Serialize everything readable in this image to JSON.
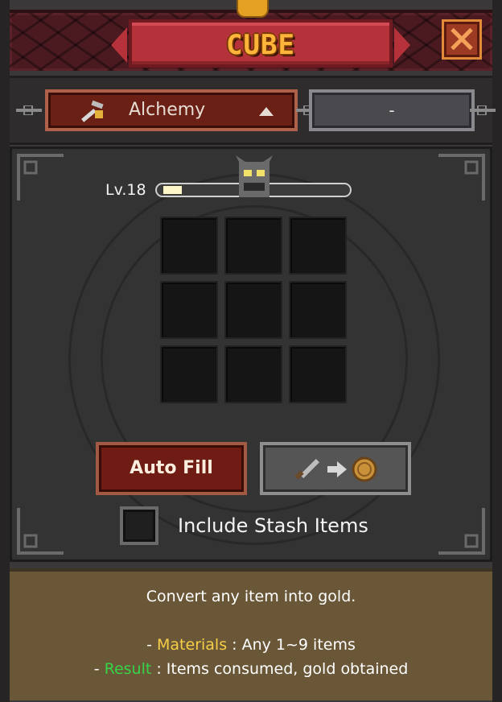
{
  "header": {
    "title": "CUBE",
    "close_icon": "close-x-icon"
  },
  "tabs": {
    "selected": {
      "label": "Alchemy",
      "icon": "pickaxe-icon",
      "arrow": "triangle-up-icon"
    },
    "other": {
      "label": "-"
    }
  },
  "cube": {
    "level_label": "Lv.18",
    "xp_fraction": 0.1,
    "slots": 9
  },
  "buttons": {
    "auto_fill": "Auto Fill",
    "convert_icons": [
      "sword-icon",
      "arrow-right-icon",
      "gold-coin-icon"
    ]
  },
  "stash": {
    "label": "Include Stash Items",
    "checked": false
  },
  "info": {
    "line1": "Convert any item into gold.",
    "materials_prefix": "- ",
    "materials_key": "Materials",
    "materials_value": " : Any 1~9 items",
    "result_prefix": "- ",
    "result_key": "Result",
    "result_value": " : Items consumed, gold obtained"
  },
  "colors": {
    "materials": "#f6cd47",
    "result": "#37d447",
    "title": "#ffb43a"
  }
}
